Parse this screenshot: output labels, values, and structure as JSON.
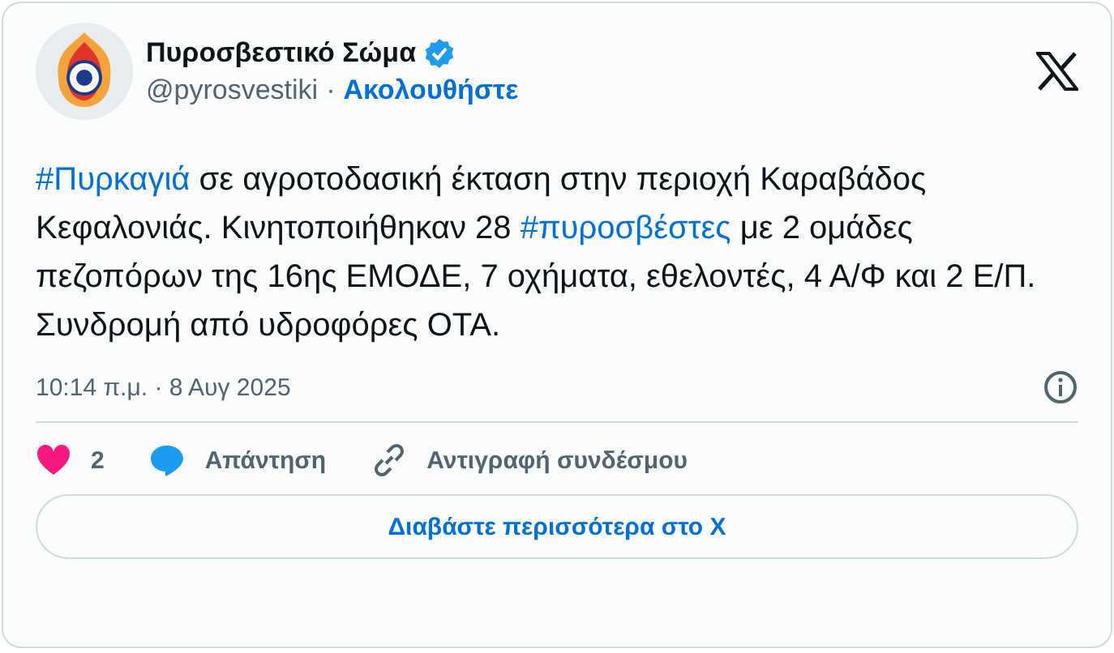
{
  "author": {
    "name": "Πυροσβεστικό Σώμα",
    "verified": true,
    "handle": "@pyrosvestiki",
    "separator": "·",
    "follow": "Ακολουθήστε"
  },
  "tweet": [
    {
      "kind": "hashtag",
      "text": "#Πυρκαγιά"
    },
    {
      "kind": "text",
      "text": " σε αγροτοδασική έκταση στην περιοχή Καραβάδος Κεφαλονιάς. Κινητοποιήθηκαν 28 "
    },
    {
      "kind": "hashtag",
      "text": "#πυροσβέστες"
    },
    {
      "kind": "text",
      "text": " με 2 ομάδες πεζοπόρων της 16ης ΕΜΟΔΕ, 7 οχήματα, εθελοντές, 4 Α/Φ και 2 Ε/Π. Συνδρομή από υδροφόρες ΟΤΑ."
    }
  ],
  "timestamp": "10:14 π.μ. · 8 Αυγ 2025",
  "actions": [
    {
      "kind": "like",
      "label": "2"
    },
    {
      "kind": "reply",
      "label": "Απάντηση"
    },
    {
      "kind": "copy",
      "label": "Αντιγραφή συνδέσμου"
    }
  ],
  "read_more": "Διαβάστε περισσότερα στο X"
}
